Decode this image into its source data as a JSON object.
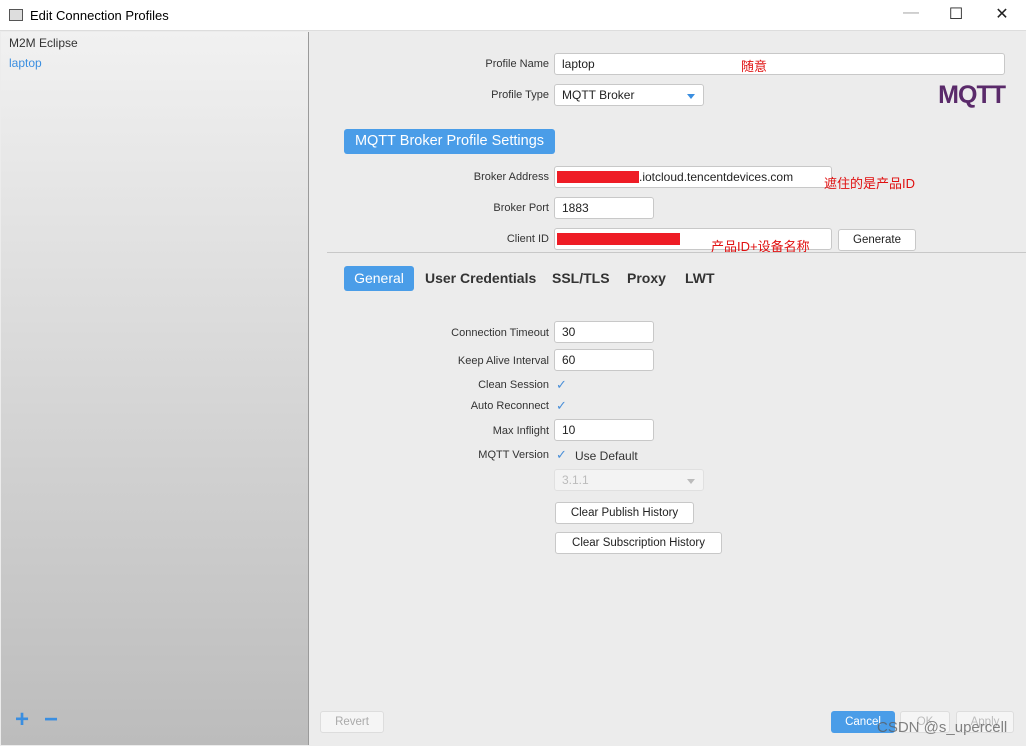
{
  "window": {
    "title": "Edit Connection Profiles",
    "minimize": "—",
    "maximize": "☐",
    "close": "✕"
  },
  "sidebar": {
    "items": [
      {
        "label": "M2M Eclipse"
      },
      {
        "label": "laptop"
      }
    ],
    "add": "+",
    "remove": "−"
  },
  "form": {
    "profile_name_label": "Profile Name",
    "profile_name": "laptop",
    "profile_name_note": "随意",
    "profile_type_label": "Profile Type",
    "profile_type": "MQTT Broker",
    "logo": "MQTT.ORG",
    "section": "MQTT Broker Profile Settings",
    "broker_address_label": "Broker Address",
    "broker_address": ".iotcloud.tencentdevices.com",
    "broker_address_note": "遮住的是产品ID",
    "broker_port_label": "Broker Port",
    "broker_port": "1883",
    "client_id_label": "Client ID",
    "client_id_note": "产品ID+设备名称",
    "generate": "Generate"
  },
  "tabs": [
    {
      "label": "General",
      "active": true
    },
    {
      "label": "User Credentials"
    },
    {
      "label": "SSL/TLS"
    },
    {
      "label": "Proxy"
    },
    {
      "label": "LWT"
    }
  ],
  "general": {
    "conn_timeout_label": "Connection Timeout",
    "conn_timeout": "30",
    "keep_alive_label": "Keep Alive Interval",
    "keep_alive": "60",
    "clean_session_label": "Clean Session",
    "clean_session": true,
    "auto_reconnect_label": "Auto Reconnect",
    "auto_reconnect": true,
    "max_inflight_label": "Max Inflight",
    "max_inflight": "10",
    "mqtt_version_label": "MQTT Version",
    "use_default_label": "Use Default",
    "use_default": true,
    "version": "3.1.1",
    "clear_publish": "Clear Publish History",
    "clear_subscription": "Clear Subscription History"
  },
  "footer": {
    "revert": "Revert",
    "cancel": "Cancel",
    "ok": "OK",
    "apply": "Apply",
    "watermark": "CSDN @s_upercell"
  },
  "colors": {
    "accent": "#4a9de8",
    "annotation": "#e01010"
  }
}
